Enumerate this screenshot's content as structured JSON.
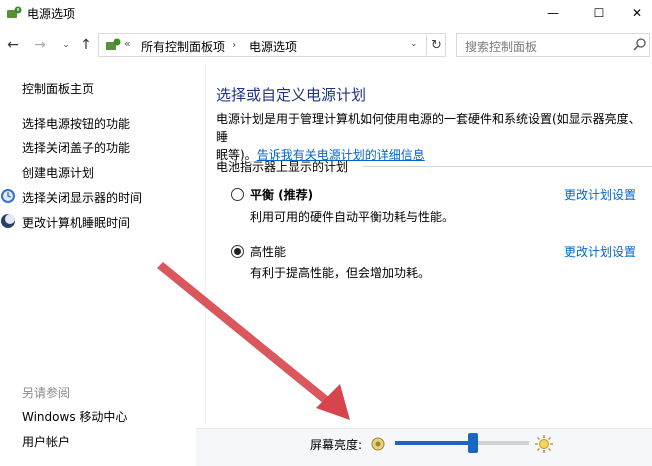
{
  "window": {
    "title": "电源选项",
    "min_glyph": "—",
    "max_glyph": "☐",
    "close_glyph": "✕"
  },
  "nav": {
    "back": "←",
    "forward": "→",
    "dropdown": "⌄",
    "up": "↑",
    "address_sep0": "«",
    "breadcrumb": [
      "所有控制面板项",
      "电源选项"
    ],
    "crumb_sep": "›",
    "address_dropdown": "⌄",
    "refresh": "↻",
    "search_placeholder": "搜索控制面板"
  },
  "sidebar": {
    "home": "控制面板主页",
    "links": [
      "选择电源按钮的功能",
      "选择关闭盖子的功能",
      "创建电源计划",
      "选择关闭显示器的时间",
      "更改计算机睡眠时间"
    ],
    "see_also_label": "另请参阅",
    "see_also": [
      "Windows 移动中心",
      "用户帐户"
    ]
  },
  "main": {
    "title": "选择或自定义电源计划",
    "desc_line1": "电源计划是用于管理计算机如何使用电源的一套硬件和系统设置(如显示器亮度、睡",
    "desc_line2_prefix": "眠等)。",
    "desc_link": "告诉我有关电源计划的详细信息",
    "group_label": "电池指示器上显示的计划",
    "plans": [
      {
        "name": "平衡 (推荐)",
        "desc": "利用可用的硬件自动平衡功耗与性能。",
        "link": "更改计划设置",
        "selected": false
      },
      {
        "name": "高性能",
        "desc": "有利于提高性能，但会增加功耗。",
        "link": "更改计划设置",
        "selected": true
      }
    ]
  },
  "bottom": {
    "brightness_label": "屏幕亮度:",
    "brightness_value": 0.58
  },
  "colors": {
    "title_blue": "#1e3287",
    "link_blue": "#0066cc",
    "slider_blue": "#1a66c2",
    "annotation_red": "#d6454c"
  }
}
